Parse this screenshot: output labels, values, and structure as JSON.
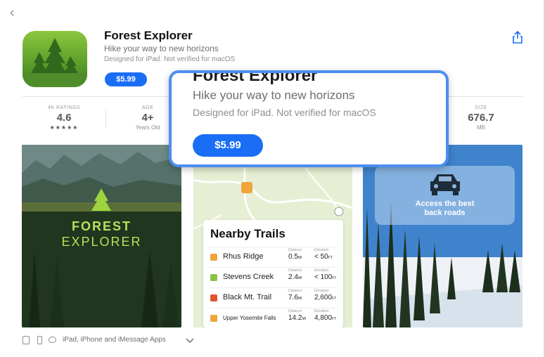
{
  "nav": {
    "back_icon": "chevron-left-icon",
    "share_icon": "share-icon"
  },
  "app": {
    "title": "Forest Explorer",
    "subtitle": "Hike your way to new horizons",
    "designed_for": "Designed for iPad. Not verified for macOS",
    "price": "$5.99"
  },
  "stats": [
    {
      "label": "4K RATINGS",
      "value": "4.6",
      "sub": "★★★★★"
    },
    {
      "label": "AGE",
      "value": "4+",
      "sub": "Years Old"
    },
    {
      "label": "SIZE",
      "value": "676.7",
      "sub": "MB"
    }
  ],
  "screenshots": {
    "forest": {
      "line1": "FOREST",
      "line2": "EXPLORER"
    },
    "trails": {
      "title": "Nearby Trails",
      "distance_label": "Distance",
      "elevation_label": "Elevation",
      "rows": [
        {
          "name": "Rhus Ridge",
          "distance": "0.5",
          "dist_unit": "MI",
          "elevation": "< 50",
          "elev_unit": "FT",
          "color": "#f0a53a"
        },
        {
          "name": "Stevens Creek",
          "distance": "2.4",
          "dist_unit": "MI",
          "elevation": "< 100",
          "elev_unit": "FT",
          "color": "#8bc34a"
        },
        {
          "name": "Black Mt. Trail",
          "distance": "7.6",
          "dist_unit": "MI",
          "elevation": "2,600",
          "elev_unit": "FT",
          "color": "#e2542f"
        },
        {
          "name": "Upper Yosemite Falls",
          "distance": "14.2",
          "dist_unit": "MI",
          "elevation": "4,800",
          "elev_unit": "FT",
          "color": "#f0a53a"
        }
      ]
    },
    "roads": {
      "line1": "Access the best",
      "line2": "back roads"
    }
  },
  "popup": {
    "title": "Forest Explorer",
    "subtitle": "Hike your way to new horizons",
    "designed_for": "Designed for iPad. Not verified for macOS",
    "price": "$5.99"
  },
  "compatibility": {
    "label": "iPad, iPhone and iMessage Apps",
    "icons": [
      "ipad-icon",
      "iphone-icon",
      "imessage-icon",
      "chevron-down-icon"
    ]
  },
  "colors": {
    "accent": "#1a6ef5",
    "highlight_border": "#4b8ef0"
  }
}
